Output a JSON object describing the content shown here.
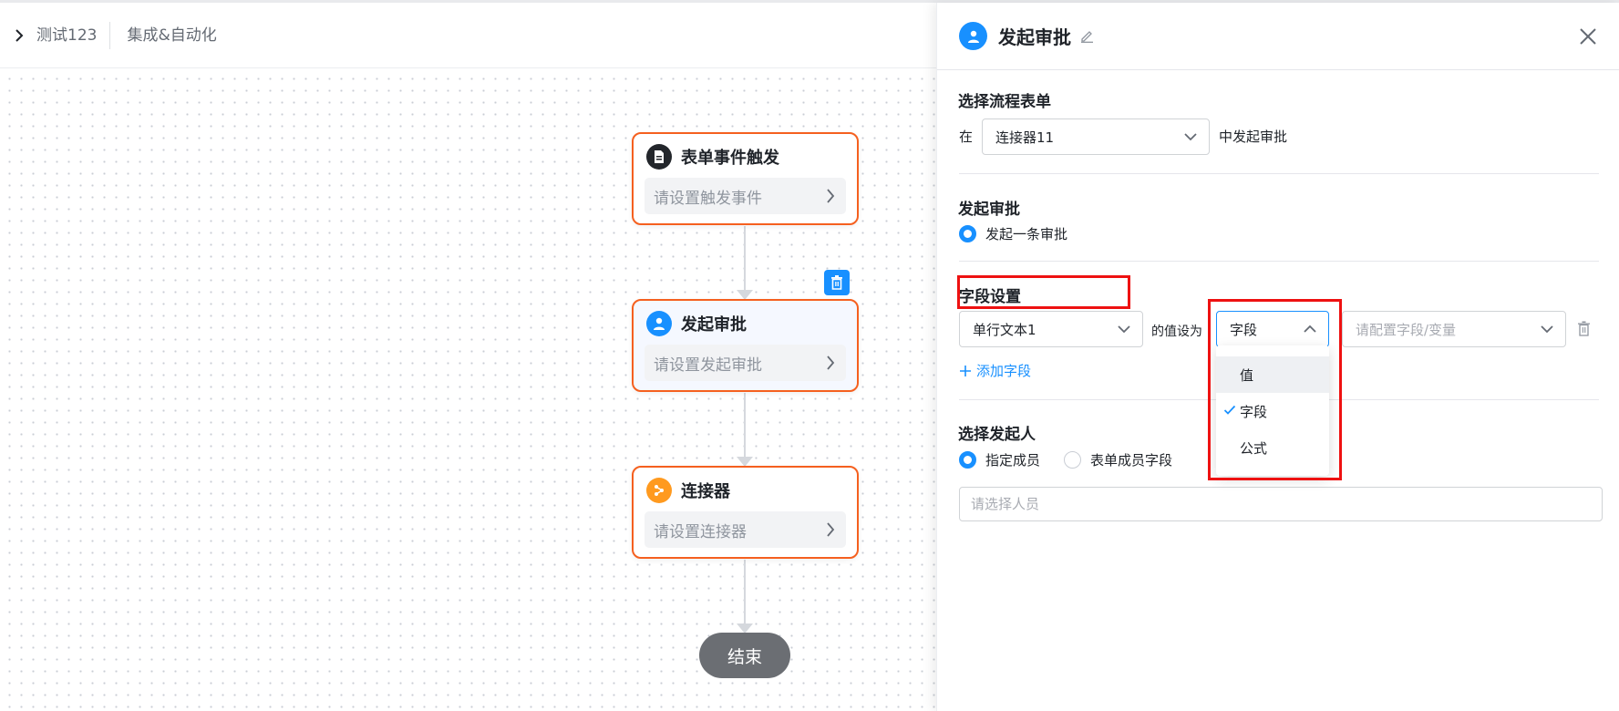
{
  "header": {
    "crumbs": [
      "测试123",
      "集成&自动化"
    ]
  },
  "canvas": {
    "nodes": [
      {
        "title": "表单事件触发",
        "placeholder": "请设置触发事件",
        "icon": "document-icon"
      },
      {
        "title": "发起审批",
        "placeholder": "请设置发起审批",
        "icon": "user-icon"
      },
      {
        "title": "连接器",
        "placeholder": "请设置连接器",
        "icon": "connector-icon"
      }
    ],
    "end_label": "结束"
  },
  "panel": {
    "title": "发起审批",
    "select_form": {
      "title": "选择流程表单",
      "prefix": "在",
      "value": "连接器11",
      "suffix": "中发起审批"
    },
    "start_approval": {
      "title": "发起审批",
      "option": "发起一条审批"
    },
    "field_settings": {
      "title": "字段设置",
      "field_value": "单行文本1",
      "value_is_label": "的值设为",
      "type_value": "字段",
      "target_placeholder": "请配置字段/变量",
      "add_field_label": "添加字段",
      "dropdown_options": [
        "值",
        "字段",
        "公式"
      ]
    },
    "initiator": {
      "title": "选择发起人",
      "options": [
        "指定成员",
        "表单成员字段"
      ],
      "person_placeholder": "请选择人员"
    }
  },
  "colors": {
    "accent": "#1890ff",
    "node_border": "#f5601f",
    "highlight": "#ee1111",
    "connector_icon": "#ff9a1f"
  }
}
